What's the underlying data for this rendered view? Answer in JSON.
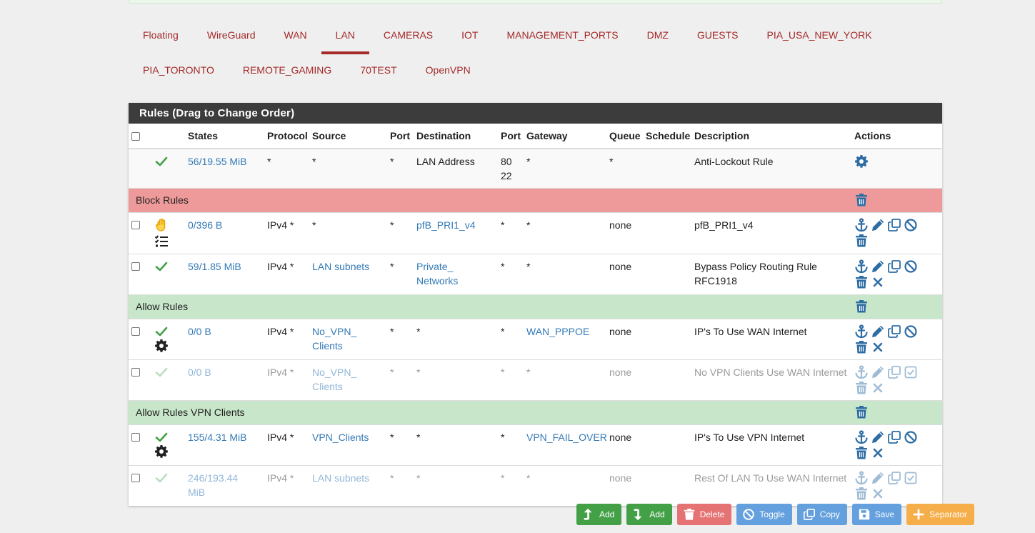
{
  "tabs_row1": [
    "Floating",
    "WireGuard",
    "WAN",
    "LAN",
    "CAMERAS",
    "IOT",
    "MANAGEMENT_PORTS",
    "DMZ",
    "GUESTS",
    "PIA_USA_NEW_YORK"
  ],
  "tabs_row2": [
    "PIA_TORONTO",
    "REMOTE_GAMING",
    "70TEST",
    "OpenVPN"
  ],
  "active_tab": "LAN",
  "panel": {
    "title": "Rules (Drag to Change Order)"
  },
  "columns": {
    "states": "States",
    "protocol": "Protocol",
    "source": "Source",
    "port": "Port",
    "destination": "Destination",
    "dport": "Port",
    "gateway": "Gateway",
    "queue": "Queue",
    "schedule": "Schedule",
    "description": "Description",
    "actions": "Actions"
  },
  "antilockout": {
    "states": "56/19.55 MiB",
    "protocol": "*",
    "source": "*",
    "port": "*",
    "destination": "LAN Address",
    "dport1": "80",
    "dport2": "22",
    "gateway": "*",
    "queue": "*",
    "description": "Anti-Lockout Rule"
  },
  "separators": {
    "block": "Block Rules",
    "allow": "Allow Rules",
    "vpn": "Allow Rules VPN Clients"
  },
  "rules": [
    {
      "states": "0/396 B",
      "protocol": "IPv4 *",
      "source": "*",
      "port": "*",
      "destination": "pfB_PRI1_v4",
      "dport": "*",
      "gateway": "*",
      "queue": "none",
      "description": "pfB_PRI1_v4"
    },
    {
      "states": "59/1.85 MiB",
      "protocol": "IPv4 *",
      "source": "LAN subnets",
      "port": "*",
      "destination": "Private_ Networks",
      "dport": "*",
      "gateway": "*",
      "queue": "none",
      "description": "Bypass Policy Routing Rule RFC1918"
    },
    {
      "states": "0/0 B",
      "protocol": "IPv4 *",
      "source": "No_VPN_ Clients",
      "port": "*",
      "destination": "*",
      "dport": "*",
      "gateway": "WAN_PPPOE",
      "queue": "none",
      "description": "IP's To Use WAN Internet"
    },
    {
      "states": "0/0 B",
      "protocol": "IPv4 *",
      "source": "No_VPN_ Clients",
      "port": "*",
      "destination": "*",
      "dport": "*",
      "gateway": "*",
      "queue": "none",
      "description": "No VPN Clients Use WAN Internet"
    },
    {
      "states": "155/4.31 MiB",
      "protocol": "IPv4 *",
      "source": "VPN_Clients",
      "port": "*",
      "destination": "*",
      "dport": "*",
      "gateway": "VPN_FAIL_OVER",
      "queue": "none",
      "description": "IP's To Use VPN Internet"
    },
    {
      "states": "246/193.44 MiB",
      "protocol": "IPv4 *",
      "source": "LAN subnets",
      "port": "*",
      "destination": "*",
      "dport": "*",
      "gateway": "*",
      "queue": "none",
      "description": "Rest Of LAN To Use WAN Internet"
    }
  ],
  "buttons": {
    "add_top": "Add",
    "add_bottom": "Add",
    "delete": "Delete",
    "toggle": "Toggle",
    "copy": "Copy",
    "save": "Save",
    "separator": "Separator"
  },
  "colors": {
    "tab": "#a52a2a",
    "link": "#337ab7",
    "icon": "#2e6da4",
    "pass": "#43a047",
    "block_sep": "#ef9a9a",
    "allow_sep": "#c8e6c9",
    "panel_head": "#3c3c3c"
  }
}
